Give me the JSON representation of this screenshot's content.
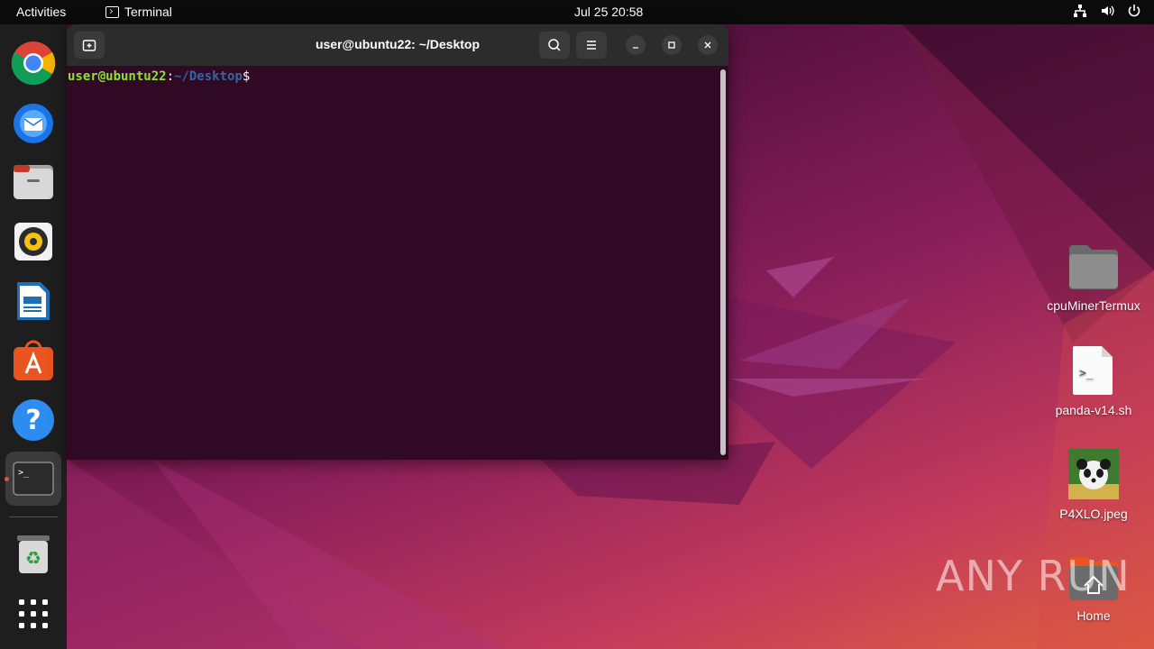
{
  "topbar": {
    "activities": "Activities",
    "app_name": "Terminal",
    "clock": "Jul 25  20:58",
    "tray_icons": [
      "network-icon",
      "volume-icon",
      "power-icon"
    ]
  },
  "dock": {
    "items": [
      {
        "name": "chrome-icon"
      },
      {
        "name": "thunderbird-icon"
      },
      {
        "name": "files-icon"
      },
      {
        "name": "rhythmbox-icon"
      },
      {
        "name": "libreoffice-writer-icon"
      },
      {
        "name": "app-center-icon"
      },
      {
        "name": "help-icon"
      },
      {
        "name": "terminal-icon",
        "running": true
      },
      {
        "name": "trash-icon"
      },
      {
        "name": "show-apps-icon"
      }
    ]
  },
  "terminal": {
    "title": "user@ubuntu22: ~/Desktop",
    "prompt_user": "user@ubuntu22",
    "prompt_colon": ":",
    "prompt_path": "~/Desktop",
    "prompt_dollar": "$"
  },
  "desktop": {
    "icons": [
      {
        "label": "cpuMinerTermux",
        "type": "folder"
      },
      {
        "label": "panda-v14.sh",
        "type": "script"
      },
      {
        "label": "P4XLO.jpeg",
        "type": "image"
      },
      {
        "label": "Home",
        "type": "home-folder"
      }
    ]
  },
  "watermark": "ANY RUN"
}
